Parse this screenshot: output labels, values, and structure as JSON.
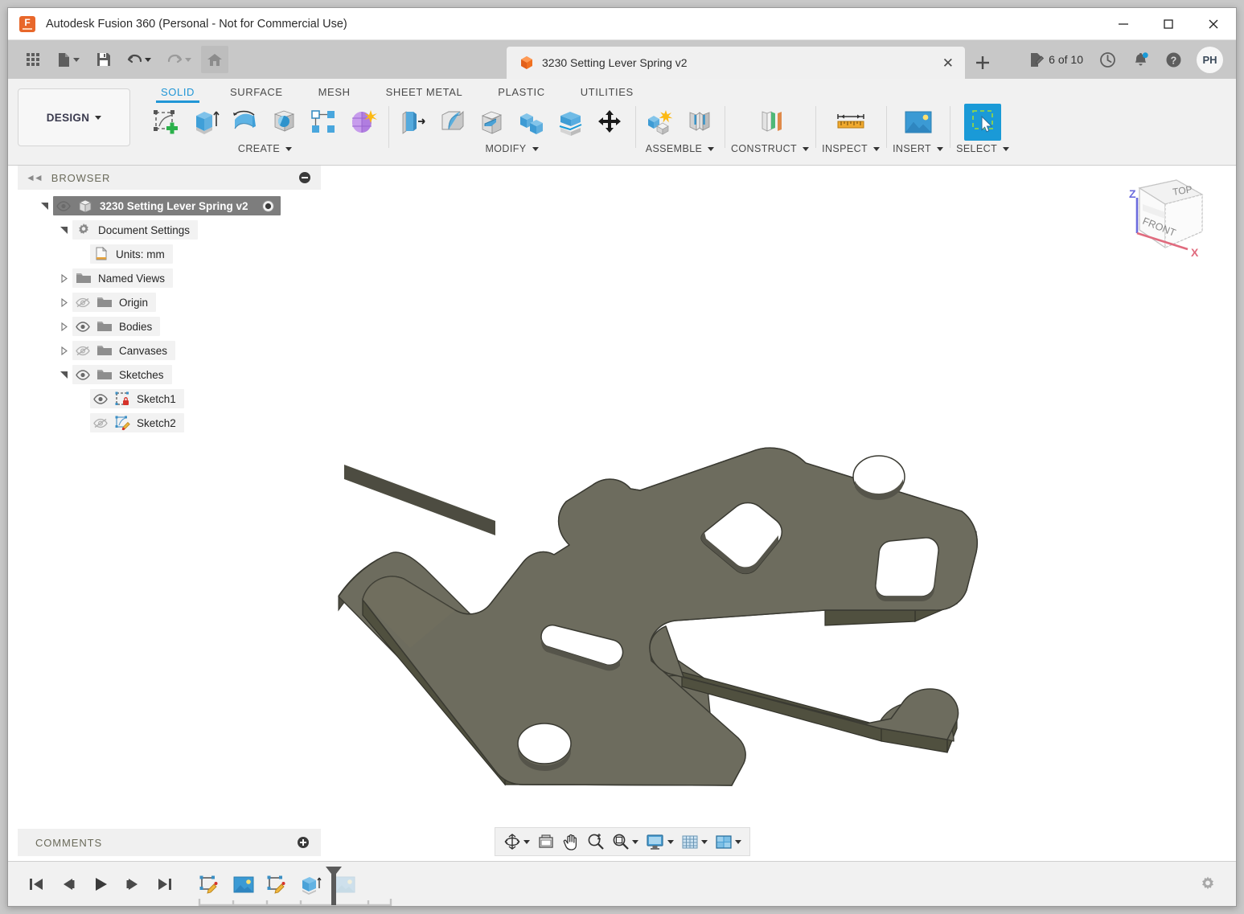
{
  "window": {
    "title": "Autodesk Fusion 360 (Personal - Not for Commercial Use)",
    "app_icon": "fusion360-logo-icon",
    "minimize_label": "—",
    "maximize_label": "□",
    "close_label": "✕"
  },
  "quick_access": {
    "items": [
      {
        "name": "app-grid-button",
        "icon": "grid-apps-icon",
        "caret": false
      },
      {
        "name": "file-menu-button",
        "icon": "file-icon",
        "caret": true
      },
      {
        "name": "save-button",
        "icon": "floppy-save-icon",
        "caret": false
      },
      {
        "name": "undo-button",
        "icon": "undo-arrow-icon",
        "caret": true
      },
      {
        "name": "redo-button",
        "icon": "redo-arrow-icon",
        "caret": true,
        "disabled": true
      },
      {
        "name": "home-button",
        "icon": "home-icon",
        "caret": false,
        "active": true
      }
    ]
  },
  "document_tab": {
    "icon": "orange-cube-icon",
    "label": "3230 Setting Lever Spring v2",
    "close_label": "✕",
    "new_tab_label": "+"
  },
  "status_bar": {
    "file_count_icon": "edit-document-icon",
    "file_count": "6 of 10",
    "history_icon": "clock-history-icon",
    "notification_icon": "bell-icon",
    "notification_badge": true,
    "help_icon": "help-question-icon",
    "avatar_initials": "PH"
  },
  "ribbon": {
    "workspace_label": "DESIGN",
    "tabs": [
      {
        "label": "SOLID",
        "active": true
      },
      {
        "label": "SURFACE",
        "active": false
      },
      {
        "label": "MESH",
        "active": false
      },
      {
        "label": "SHEET METAL",
        "active": false
      },
      {
        "label": "PLASTIC",
        "active": false
      },
      {
        "label": "UTILITIES",
        "active": false
      }
    ],
    "groups": [
      {
        "label": "CREATE",
        "has_caret": true,
        "icons": [
          "create-sketch-icon",
          "extrude-icon",
          "revolve-icon",
          "sweep-icon",
          "pattern-rectangular-icon",
          "form-icon"
        ]
      },
      {
        "label": "MODIFY",
        "has_caret": true,
        "icons": [
          "press-pull-icon",
          "fillet-icon",
          "shell-icon",
          "combine-icon",
          "split-face-icon",
          "move-copy-icon"
        ]
      },
      {
        "label": "ASSEMBLE",
        "has_caret": true,
        "icons": [
          "new-component-icon",
          "joint-icon"
        ]
      },
      {
        "label": "CONSTRUCT",
        "has_caret": true,
        "icons": [
          "offset-plane-icon"
        ]
      },
      {
        "label": "INSPECT",
        "has_caret": true,
        "icons": [
          "measure-ruler-icon"
        ]
      },
      {
        "label": "INSERT",
        "has_caret": true,
        "icons": [
          "insert-image-icon"
        ]
      },
      {
        "label": "SELECT",
        "has_caret": true,
        "selected_index": 0,
        "icons": [
          "select-window-cursor-icon"
        ]
      }
    ]
  },
  "browser": {
    "header": "BROWSER",
    "collapse_icon": "collapse-left-arrows-icon",
    "header_button_icon": "minus-circle-icon",
    "tree": [
      {
        "label": "3230 Setting Lever Spring v2",
        "indent": 0,
        "twisty": "down",
        "eye": "visible",
        "icon": "component-cube-icon",
        "selected": true,
        "radio": true
      },
      {
        "label": "Document Settings",
        "indent": 1,
        "twisty": "down",
        "eye": "none",
        "icon": "gear-icon",
        "selected": false
      },
      {
        "label": "Units: mm",
        "indent": 2,
        "twisty": "none",
        "eye": "none",
        "icon": "units-document-icon",
        "selected": false
      },
      {
        "label": "Named Views",
        "indent": 1,
        "twisty": "right",
        "eye": "none",
        "icon": "folder-icon",
        "selected": false
      },
      {
        "label": "Origin",
        "indent": 1,
        "twisty": "right",
        "eye": "hidden",
        "icon": "folder-icon",
        "selected": false
      },
      {
        "label": "Bodies",
        "indent": 1,
        "twisty": "right",
        "eye": "visible",
        "icon": "folder-icon",
        "selected": false
      },
      {
        "label": "Canvases",
        "indent": 1,
        "twisty": "right",
        "eye": "hidden",
        "icon": "folder-icon",
        "selected": false
      },
      {
        "label": "Sketches",
        "indent": 1,
        "twisty": "down",
        "eye": "visible",
        "icon": "folder-icon",
        "selected": false
      },
      {
        "label": "Sketch1",
        "indent": 2,
        "twisty": "none",
        "eye": "visible",
        "icon": "sketch-locked-icon",
        "selected": false
      },
      {
        "label": "Sketch2",
        "indent": 2,
        "twisty": "none",
        "eye": "hidden",
        "icon": "sketch-edit-icon",
        "selected": false
      }
    ]
  },
  "viewcube": {
    "top_face_label": "TOP",
    "front_face_label": "FRONT",
    "axis_z_label": "Z",
    "axis_x_label": "X"
  },
  "navigation_bar": {
    "buttons": [
      {
        "name": "orbit-button",
        "icon": "orbit-icon",
        "caret": true
      },
      {
        "name": "look-at-button",
        "icon": "look-at-icon",
        "caret": false
      },
      {
        "name": "pan-button",
        "icon": "pan-hand-icon",
        "caret": false
      },
      {
        "name": "zoom-button",
        "icon": "zoom-magnifier-icon",
        "caret": false
      },
      {
        "name": "fit-button",
        "icon": "zoom-fit-icon",
        "caret": true
      },
      {
        "name": "display-settings-button",
        "icon": "display-monitor-icon",
        "caret": true
      },
      {
        "name": "grid-snaps-button",
        "icon": "grid-icon",
        "caret": true
      },
      {
        "name": "viewports-button",
        "icon": "viewports-icon",
        "caret": true
      }
    ]
  },
  "comments": {
    "label": "COMMENTS",
    "add_icon": "plus-circle-icon"
  },
  "timeline": {
    "playback": [
      {
        "name": "timeline-go-to-beginning",
        "icon": "skip-to-start-icon"
      },
      {
        "name": "timeline-step-back",
        "icon": "step-back-icon"
      },
      {
        "name": "timeline-play",
        "icon": "play-icon"
      },
      {
        "name": "timeline-step-forward",
        "icon": "step-forward-icon"
      },
      {
        "name": "timeline-go-to-end",
        "icon": "skip-to-end-icon"
      }
    ],
    "features": [
      {
        "name": "timeline-feature-sketch1",
        "icon": "sketch-feature-icon",
        "dimmed": false
      },
      {
        "name": "timeline-feature-canvas1",
        "icon": "canvas-image-icon",
        "dimmed": false
      },
      {
        "name": "timeline-feature-sketch2",
        "icon": "sketch-feature-icon",
        "dimmed": false
      },
      {
        "name": "timeline-feature-extrude",
        "icon": "extrude-feature-icon",
        "dimmed": false
      },
      {
        "name": "timeline-feature-canvas2",
        "icon": "canvas-image-icon",
        "dimmed": true
      }
    ],
    "marker_position_index": 4,
    "settings_icon": "gear-icon"
  },
  "model": {
    "name": "3230-setting-lever-spring-part",
    "body_fill": "#6d6c5e",
    "body_fill_dark": "#5b5a4d",
    "edge_color": "#3a3a32",
    "background": "#ffffff"
  },
  "colors": {
    "accent_blue": "#2196d6",
    "chrome_gray": "#c8c8c8",
    "ribbon_gray": "#f1f1f1",
    "panel_label": "#6a6a5a",
    "orange": "#e8672a"
  }
}
